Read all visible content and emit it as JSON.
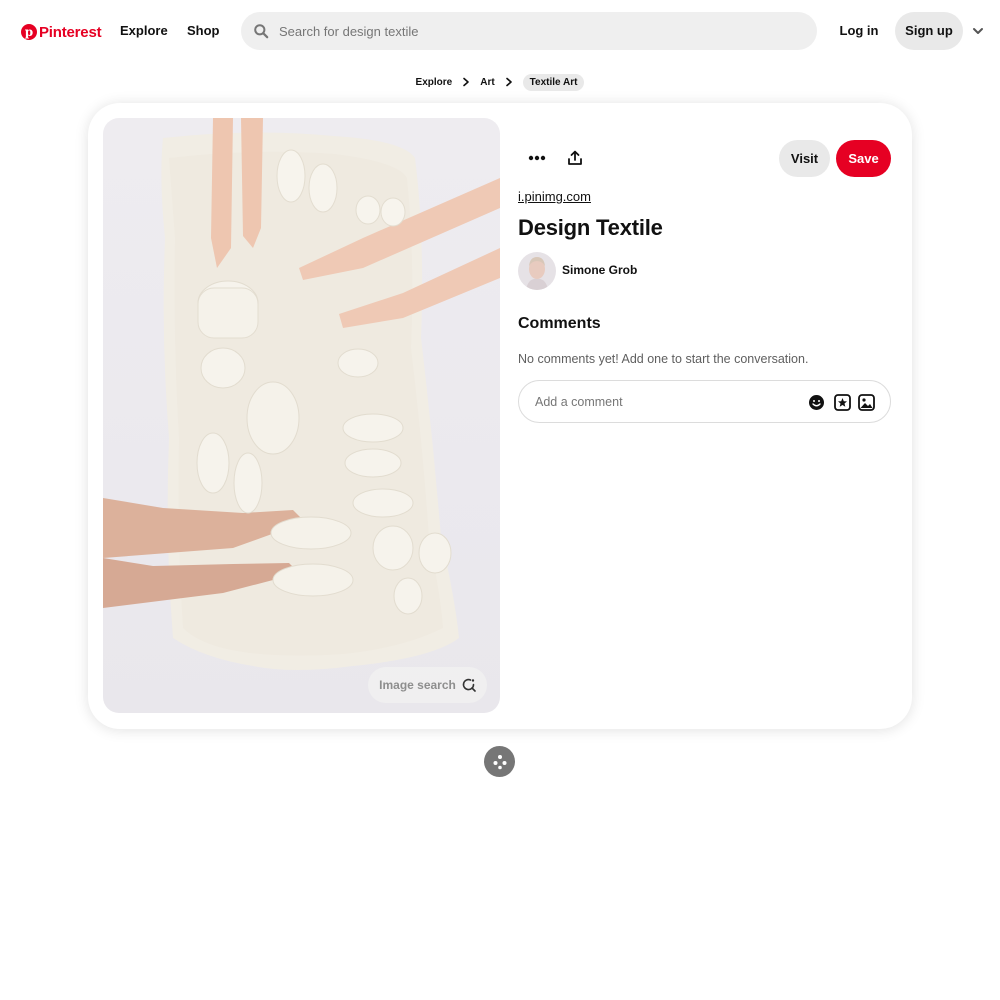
{
  "header": {
    "logo_text": "Pinterest",
    "nav": {
      "explore": "Explore",
      "shop": "Shop"
    },
    "search": {
      "placeholder": "Search for design textile",
      "value": ""
    },
    "login_label": "Log in",
    "signup_label": "Sign up"
  },
  "breadcrumb": [
    {
      "label": "Explore"
    },
    {
      "label": "Art"
    },
    {
      "label": "Textile Art"
    }
  ],
  "pin": {
    "image_search_label": "Image search",
    "visit_label": "Visit",
    "save_label": "Save",
    "source": "i.pinimg.com",
    "title": "Design Textile",
    "author": "Simone Grob"
  },
  "comments": {
    "heading": "Comments",
    "empty_text": "No comments yet! Add one to start the conversation.",
    "placeholder": "Add a comment"
  },
  "colors": {
    "brand": "#e60023",
    "pill_gray": "#e9e9e9",
    "search_bg": "#efefef"
  },
  "icons": {
    "search": "search-icon",
    "menu_chevron": "chevron-down-icon",
    "breadcrumb_sep": "chevron-right-icon",
    "more": "ellipsis-icon",
    "share": "share-icon",
    "lens": "lens-icon",
    "emoji": "emoji-icon",
    "sticker": "sticker-icon",
    "photo": "photo-icon",
    "more_ideas": "more-ideas-icon"
  }
}
